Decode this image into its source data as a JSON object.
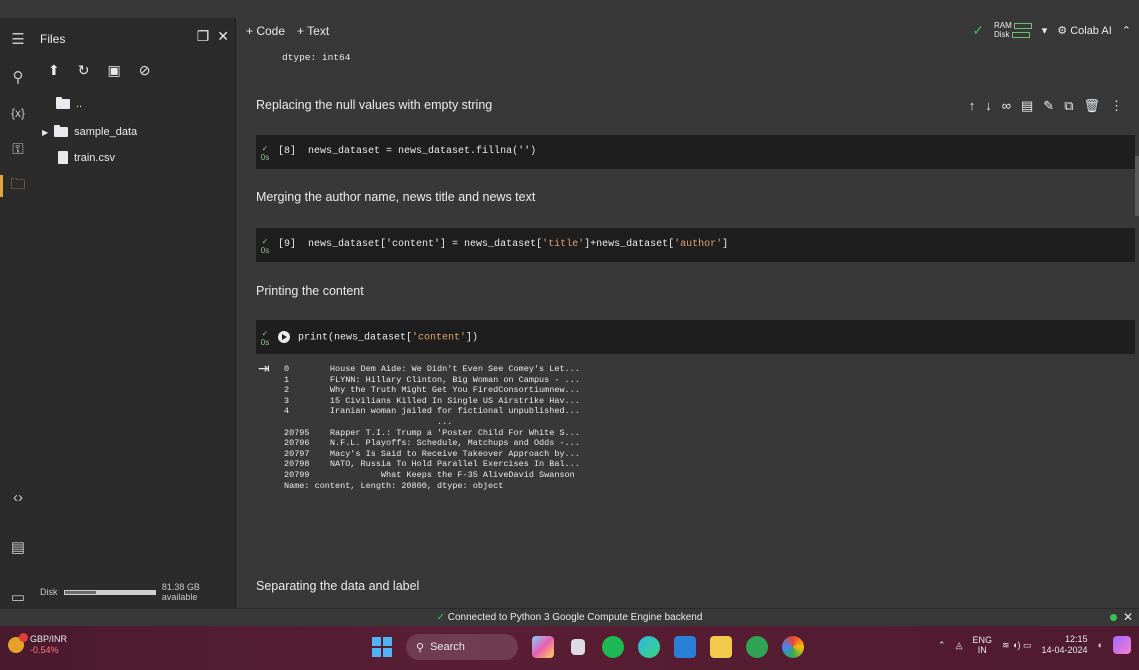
{
  "files_panel": {
    "title": "Files",
    "parent_folder": "..",
    "items": [
      "sample_data",
      "train.csv"
    ],
    "disk_label": "Disk",
    "disk_available": "81.38 GB available",
    "disk_used_fraction": 0.35
  },
  "toolbar": {
    "add_code": "+ Code",
    "add_text": "+ Text",
    "ram_label": "RAM",
    "disk_label": "Disk",
    "colab_ai": "Colab AI"
  },
  "cells": {
    "prev_output_tail": "dtype: int64",
    "md1": "Replacing the null values with empty string",
    "c8_num": "[8]",
    "c8_code": "news_dataset = news_dataset.fillna('')",
    "c8_time": "0s",
    "md2": "Merging the author name, news title and news text",
    "c9_num": "[9]",
    "c9_code_a": "news_dataset['content'] = news_dataset[",
    "c9_str1": "'title'",
    "c9_code_b": "]+news_dataset[",
    "c9_str2": "'author'",
    "c9_code_c": "]",
    "c9_time": "0s",
    "md3": "Printing the content",
    "c10_code_a": "print(news_dataset[",
    "c10_str": "'content'",
    "c10_code_b": "])",
    "c10_time": "0s",
    "output_lines": [
      "0        House Dem Aide: We Didn't Even See Comey's Let...",
      "1        FLYNN: Hillary Clinton, Big Woman on Campus - ...",
      "2        Why the Truth Might Get You FiredConsortiumnew...",
      "3        15 Civilians Killed In Single US Airstrike Hav...",
      "4        Iranian woman jailed for fictional unpublished...",
      "                              ...",
      "20795    Rapper T.I.: Trump a 'Poster Child For White S...",
      "20796    N.F.L. Playoffs: Schedule, Matchups and Odds -...",
      "20797    Macy's Is Said to Receive Takeover Approach by...",
      "20798    NATO, Russia To Hold Parallel Exercises In Bal...",
      "20799              What Keeps the F-35 AliveDavid Swanson",
      "Name: content, Length: 20800, dtype: object"
    ],
    "md4": "Separating the data and label"
  },
  "status_bar": {
    "connected": "Connected to Python 3 Google Compute Engine backend"
  },
  "taskbar": {
    "ticker_name": "GBP/INR",
    "ticker_change": "-0.54%",
    "search_placeholder": "Search",
    "lang_top": "ENG",
    "lang_bottom": "IN",
    "time": "12:15",
    "date": "14-04-2024"
  },
  "colors": {
    "accent_orange": "#e6a23c",
    "success_green": "#3cc05a",
    "string_orange": "#e0a36b"
  }
}
